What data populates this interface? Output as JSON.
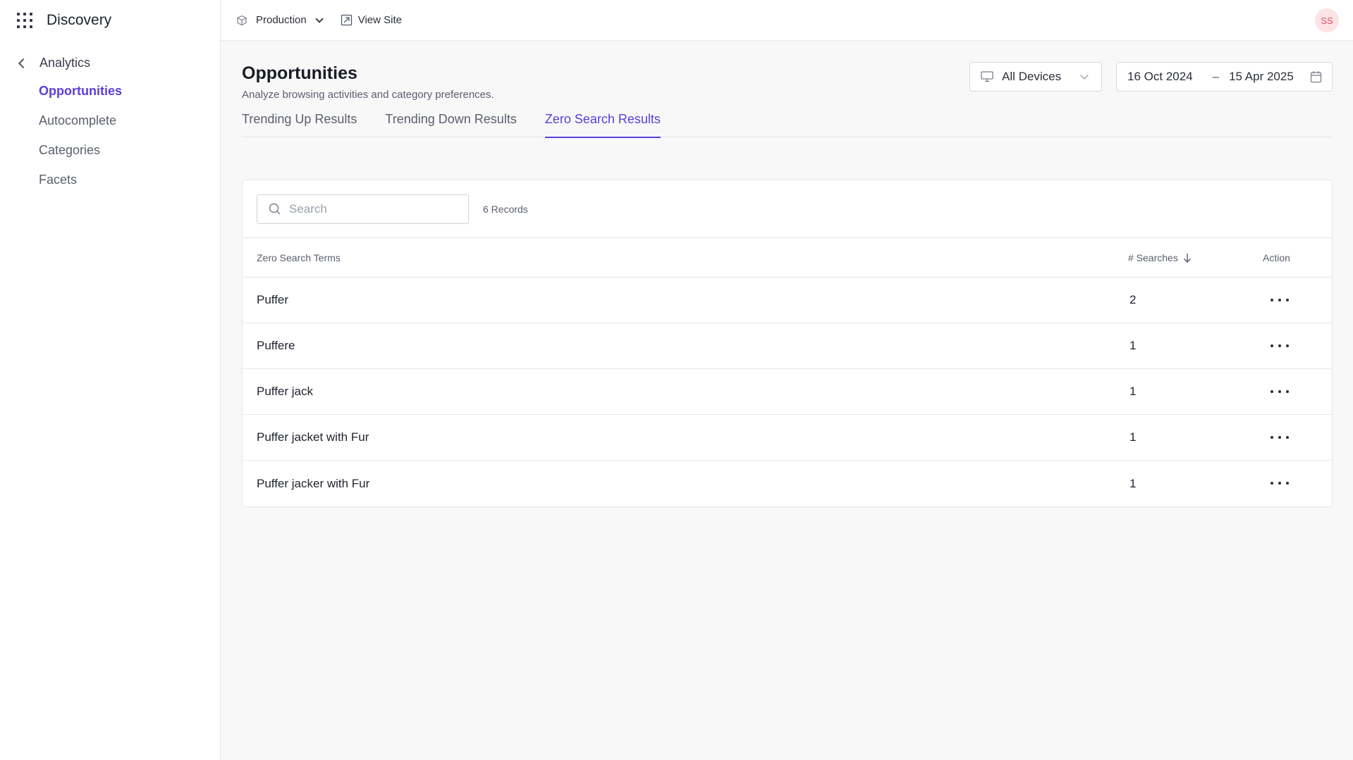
{
  "app": {
    "name": "Discovery"
  },
  "sidebar": {
    "back_label": "Analytics",
    "items": [
      {
        "label": "Opportunities",
        "active": true
      },
      {
        "label": "Autocomplete",
        "active": false
      },
      {
        "label": "Categories",
        "active": false
      },
      {
        "label": "Facets",
        "active": false
      }
    ]
  },
  "topbar": {
    "environment": "Production",
    "view_site": "View Site",
    "user_initials": "SS"
  },
  "page": {
    "title": "Opportunities",
    "subtitle": "Analyze browsing activities and category preferences."
  },
  "filters": {
    "device": "All Devices",
    "date_from": "16 Oct 2024",
    "date_to": "15 Apr 2025",
    "date_separator": "–"
  },
  "tabs": [
    {
      "label": "Trending Up Results",
      "active": false
    },
    {
      "label": "Trending Down Results",
      "active": false
    },
    {
      "label": "Zero Search Results",
      "active": true
    }
  ],
  "table": {
    "search_placeholder": "Search",
    "records_label": "6 Records",
    "headers": {
      "term": "Zero Search Terms",
      "count": "# Searches",
      "action": "Action"
    },
    "rows": [
      {
        "term": "Puffer",
        "count": "2"
      },
      {
        "term": "Puffere",
        "count": "1"
      },
      {
        "term": "Puffer jack",
        "count": "1"
      },
      {
        "term": "Puffer jacket with Fur",
        "count": "1"
      },
      {
        "term": "Puffer jacker with Fur",
        "count": "1"
      }
    ]
  },
  "colors": {
    "accent": "#5b3ddb",
    "avatar_bg": "#fde3e6",
    "avatar_text": "#d9516b"
  }
}
